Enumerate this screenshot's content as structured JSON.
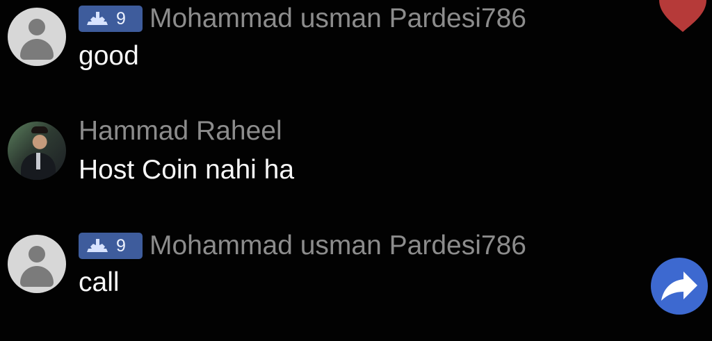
{
  "messages": [
    {
      "avatar": "default-avatar",
      "badge": {
        "icon": "user-level-icon",
        "level": "9"
      },
      "name": "Mohammad usman Pardesi786",
      "text": "good"
    },
    {
      "avatar": "photo-avatar",
      "name": "Hammad Raheel",
      "text": "Host Coin nahi ha"
    },
    {
      "avatar": "default-avatar",
      "badge": {
        "icon": "user-level-icon",
        "level": "9"
      },
      "name": "Mohammad usman Pardesi786",
      "text": "call"
    }
  ],
  "controls": {
    "like_icon": "heart-icon",
    "share_icon": "share-arrow-icon"
  },
  "colors": {
    "background": "#020202",
    "badge": "#3e5c9c",
    "name": "#8c8c8c",
    "message": "#f7f7f7",
    "heart": "#b63a39",
    "share": "#3d69d0"
  }
}
